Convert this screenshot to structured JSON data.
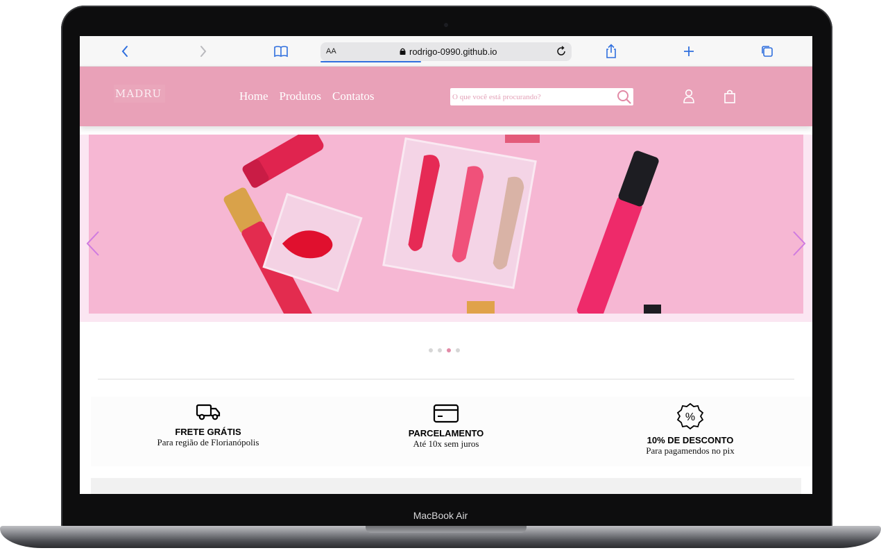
{
  "device": {
    "label": "MacBook Air"
  },
  "browser": {
    "url_text_size_label": "AA",
    "url": "rodrigo-0990.github.io",
    "accent_color": "#2f6fde",
    "icons": [
      "back-icon",
      "forward-icon",
      "bookmarks-icon",
      "lock-icon",
      "reload-icon",
      "share-icon",
      "new-tab-icon",
      "tabs-icon"
    ]
  },
  "site": {
    "brand_color": "#e9a1b8",
    "logo_text": "MADRU",
    "nav": [
      {
        "label": "Home"
      },
      {
        "label": "Produtos"
      },
      {
        "label": "Contatos"
      }
    ],
    "search": {
      "placeholder": "O que você está procurando?",
      "value": ""
    },
    "header_icons": [
      "user-icon",
      "shopping-bag-icon"
    ]
  },
  "carousel": {
    "slide_count": 4,
    "active_slide": 3,
    "arrow_color": "#cf7ae0"
  },
  "features": [
    {
      "icon": "truck-icon",
      "title": "FRETE GRÁTIS",
      "subtitle": "Para região de Florianópolis"
    },
    {
      "icon": "credit-card-icon",
      "title": "PARCELAMENTO",
      "subtitle": "Até 10x sem juros"
    },
    {
      "icon": "discount-badge-icon",
      "title": "10% DE DESCONTO",
      "subtitle": "Para pagamendos no pix"
    }
  ]
}
